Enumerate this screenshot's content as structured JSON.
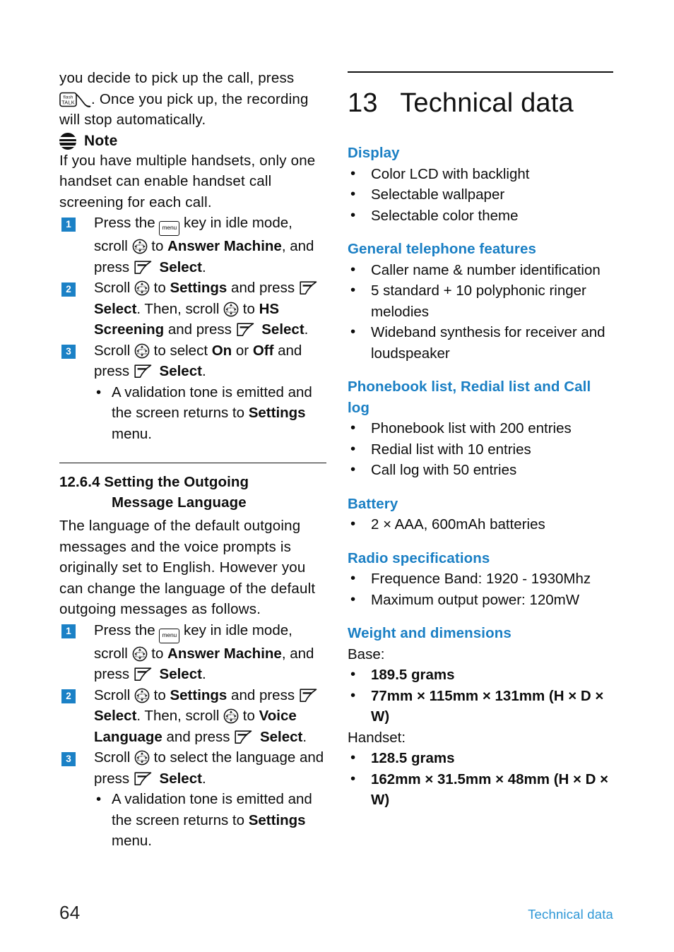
{
  "page": {
    "number": "64",
    "footer_label": "Technical data"
  },
  "left_column": {
    "intro_paragraph": {
      "before_icon": "you decide to pick up the call, press ",
      "icon": "talk-key-icon",
      "after_icon": ".",
      "line2": "Once you pick up, the recording will stop",
      "line3": "automatically."
    },
    "note": {
      "icon": "note-icon",
      "title": "Note",
      "body": "If you have multiple handsets, only one handset can enable handset call screening for each call."
    },
    "procedure_1": {
      "steps": [
        {
          "number": "1",
          "parts": [
            {
              "t": "text",
              "v": "Press the "
            },
            {
              "t": "icon",
              "v": "menu-key-icon",
              "label": "menu"
            },
            {
              "t": "text",
              "v": " key in idle mode, scroll "
            },
            {
              "t": "icon",
              "v": "nav-key-icon"
            },
            {
              "t": "text",
              "v": " to "
            },
            {
              "t": "bold",
              "v": "Answer Machine"
            },
            {
              "t": "text",
              "v": ", and press "
            },
            {
              "t": "icon",
              "v": "soft-key-icon"
            },
            {
              "t": "bold",
              "v": " Select"
            },
            {
              "t": "text",
              "v": "."
            }
          ]
        },
        {
          "number": "2",
          "parts": [
            {
              "t": "text",
              "v": "Scroll "
            },
            {
              "t": "icon",
              "v": "nav-key-icon"
            },
            {
              "t": "text",
              "v": " to "
            },
            {
              "t": "bold",
              "v": "Settings"
            },
            {
              "t": "text",
              "v": " and press "
            },
            {
              "t": "icon",
              "v": "soft-key-icon"
            },
            {
              "t": "bold",
              "v": " Select"
            },
            {
              "t": "text",
              "v": ". Then, scroll "
            },
            {
              "t": "icon",
              "v": "nav-key-icon"
            },
            {
              "t": "text",
              "v": " to "
            },
            {
              "t": "bold",
              "v": "HS Screening"
            },
            {
              "t": "text",
              "v": " and press "
            },
            {
              "t": "icon",
              "v": "soft-key-icon"
            },
            {
              "t": "bold",
              "v": " Select"
            },
            {
              "t": "text",
              "v": "."
            }
          ]
        },
        {
          "number": "3",
          "parts": [
            {
              "t": "text",
              "v": "Scroll "
            },
            {
              "t": "icon",
              "v": "nav-key-icon"
            },
            {
              "t": "text",
              "v": " to select "
            },
            {
              "t": "bold",
              "v": "On"
            },
            {
              "t": "text",
              "v": " or "
            },
            {
              "t": "bold",
              "v": "Off"
            },
            {
              "t": "text",
              "v": " and press "
            },
            {
              "t": "icon",
              "v": "soft-key-icon"
            },
            {
              "t": "bold",
              "v": " Select"
            },
            {
              "t": "text",
              "v": "."
            }
          ]
        }
      ],
      "result_bullet": {
        "bullet": "•",
        "before": "A validation tone is emitted and the screen returns to ",
        "bold": "Settings",
        "after": " menu."
      }
    },
    "section_12_6_4": {
      "number_and_title_line1": "12.6.4 Setting the Outgoing",
      "title_line2": "Message Language",
      "paragraph": "The language of the default outgoing messages and the voice prompts is originally set to English. However you can change the language of the default outgoing messages as follows."
    },
    "procedure_2": {
      "steps": [
        {
          "number": "1",
          "parts": [
            {
              "t": "text",
              "v": "Press the "
            },
            {
              "t": "icon",
              "v": "menu-key-icon",
              "label": "menu"
            },
            {
              "t": "text",
              "v": " key in idle mode, scroll "
            },
            {
              "t": "icon",
              "v": "nav-key-icon"
            },
            {
              "t": "text",
              "v": " to "
            },
            {
              "t": "bold",
              "v": "Answer Machine"
            },
            {
              "t": "text",
              "v": ", and press "
            },
            {
              "t": "icon",
              "v": "soft-key-icon"
            },
            {
              "t": "bold",
              "v": " Select"
            },
            {
              "t": "text",
              "v": "."
            }
          ]
        },
        {
          "number": "2",
          "parts": [
            {
              "t": "text",
              "v": "Scroll "
            },
            {
              "t": "icon",
              "v": "nav-key-icon"
            },
            {
              "t": "text",
              "v": " to "
            },
            {
              "t": "bold",
              "v": "Settings"
            },
            {
              "t": "text",
              "v": " and press "
            },
            {
              "t": "icon",
              "v": "soft-key-icon"
            },
            {
              "t": "bold",
              "v": " Select"
            },
            {
              "t": "text",
              "v": ". Then, scroll "
            },
            {
              "t": "icon",
              "v": "nav-key-icon"
            },
            {
              "t": "text",
              "v": " to "
            },
            {
              "t": "bold",
              "v": "Voice Language"
            },
            {
              "t": "text",
              "v": " and press "
            },
            {
              "t": "icon",
              "v": "soft-key-icon"
            },
            {
              "t": "bold",
              "v": " Select"
            },
            {
              "t": "text",
              "v": "."
            }
          ]
        },
        {
          "number": "3",
          "parts": [
            {
              "t": "text",
              "v": "Scroll "
            },
            {
              "t": "icon",
              "v": "nav-key-icon"
            },
            {
              "t": "text",
              "v": " to select the language and press "
            },
            {
              "t": "icon",
              "v": "soft-key-icon"
            },
            {
              "t": "bold",
              "v": " Select"
            },
            {
              "t": "text",
              "v": "."
            }
          ]
        }
      ],
      "result_bullet": {
        "bullet": "•",
        "before": "A validation tone is emitted and the screen returns to ",
        "bold": "Settings",
        "after": " menu."
      }
    }
  },
  "right_column": {
    "chapter_number": "13",
    "chapter_title": "Technical data",
    "sections": [
      {
        "heading": "Display",
        "items": [
          "Color LCD with backlight",
          "Selectable wallpaper",
          "Selectable color theme"
        ]
      },
      {
        "heading": "General telephone features",
        "items": [
          "Caller name & number identification",
          "5 standard + 10 polyphonic ringer melodies",
          "Wideband synthesis for receiver and loudspeaker"
        ]
      },
      {
        "heading": "Phonebook list, Redial list and Call log",
        "items": [
          "Phonebook list with 200 entries",
          "Redial list with 10 entries",
          "Call log with 50 entries"
        ]
      },
      {
        "heading": "Battery",
        "items": [
          "2 × AAA, 600mAh batteries"
        ]
      },
      {
        "heading": "Radio specifications",
        "items": [
          "Frequence Band: 1920 - 1930Mhz",
          "Maximum output power: 120mW"
        ]
      },
      {
        "heading": "Weight and dimensions",
        "groups": [
          {
            "label": "Base:",
            "items": [
              "189.5 grams",
              "77mm × 115mm × 131mm (H × D × W)"
            ]
          },
          {
            "label": "Handset:",
            "items": [
              "128.5 grams",
              "162mm × 31.5mm × 48mm (H × D × W)"
            ]
          }
        ]
      }
    ]
  },
  "colors": {
    "heading_blue": "#1a7fc4",
    "badge_blue": "#1b81c6",
    "footer_blue": "#2e97d6",
    "text_black": "#0d0d0d"
  },
  "icons": {
    "bullet": "•",
    "menu_label": "menu",
    "talk_top": "flash",
    "talk_bottom": "TALK",
    "nav_top": "call ID",
    "nav_bottom": "Ph.Book"
  }
}
